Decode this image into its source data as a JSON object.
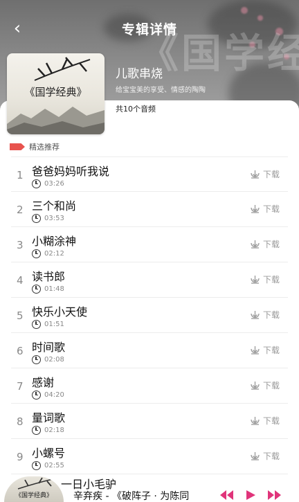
{
  "header": {
    "title": "专辑详情",
    "back_label": "‹",
    "watermark": "《国学经典》"
  },
  "album": {
    "cover_title": "《国学经典》",
    "name": "儿歌串烧",
    "description": "给宝宝美的享受、情感的陶陶",
    "track_count": "共10个音频"
  },
  "section": {
    "label": "精选推荐",
    "accent": "#e8534e"
  },
  "tracks": [
    {
      "num": "1",
      "name": "爸爸妈妈听我说",
      "duration": "03:26",
      "download": "下载"
    },
    {
      "num": "2",
      "name": "三个和尚",
      "duration": "03:53",
      "download": "下载"
    },
    {
      "num": "3",
      "name": "小糊涂神",
      "duration": "02:12",
      "download": "下载"
    },
    {
      "num": "4",
      "name": "读书郎",
      "duration": "01:48",
      "download": "下载"
    },
    {
      "num": "5",
      "name": "快乐小天使",
      "duration": "01:51",
      "download": "下载"
    },
    {
      "num": "6",
      "name": "时间歌",
      "duration": "02:08",
      "download": "下载"
    },
    {
      "num": "7",
      "name": "感谢",
      "duration": "04:20",
      "download": "下载"
    },
    {
      "num": "8",
      "name": "量词歌",
      "duration": "02:18",
      "download": "下载"
    },
    {
      "num": "9",
      "name": "小螺号",
      "duration": "02:55",
      "download": "下载"
    }
  ],
  "partial_track": "一日小毛驴",
  "player": {
    "cover_title": "《国学经典》",
    "song": "辛弃疾 - 《破阵子 · 为陈同",
    "accent": "#e0347a"
  }
}
